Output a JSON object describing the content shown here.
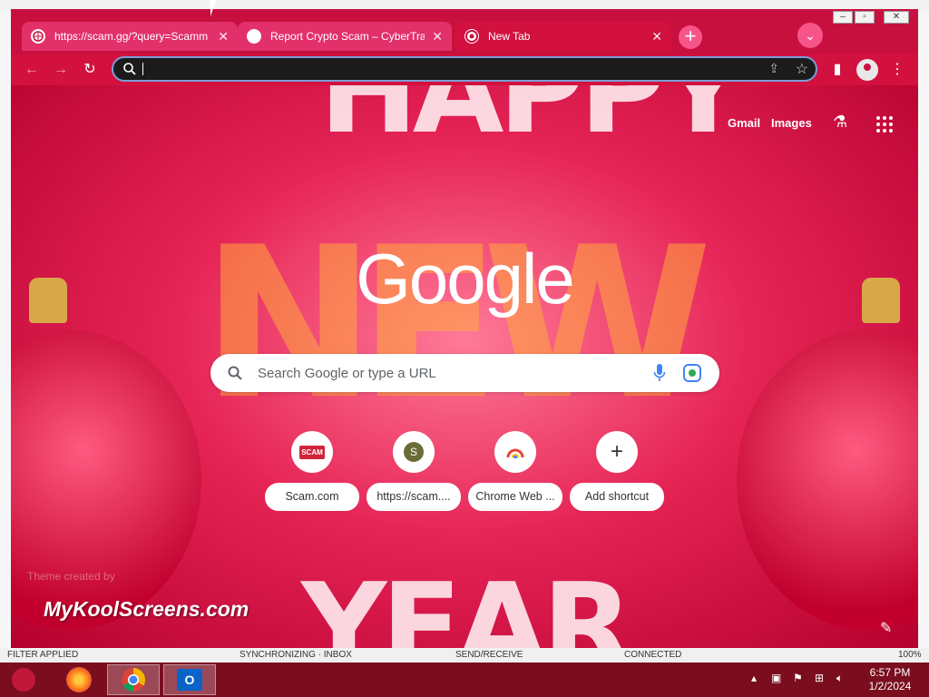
{
  "tabs": [
    {
      "title": "https://scam.gg/?query=Scamm",
      "active": false
    },
    {
      "title": "Report Crypto Scam – CyberTrail",
      "active": false
    },
    {
      "title": "New Tab",
      "active": true
    }
  ],
  "omnibox": {
    "value": ""
  },
  "ntp": {
    "gmail": "Gmail",
    "images": "Images",
    "logo": "Google",
    "search_placeholder": "Search Google or type a URL",
    "shortcuts": [
      {
        "label": "Scam.com",
        "icon_text": "SCAM"
      },
      {
        "label": "https://scam....",
        "icon_text": "S"
      },
      {
        "label": "Chrome Web ...",
        "icon_text": ""
      },
      {
        "label": "Add shortcut",
        "icon_text": "+"
      }
    ],
    "theme_credit": "Theme created by",
    "watermark": "MyKoolScreens.com",
    "art_text_top": "HAPPY",
    "art_text_middle": "NEW",
    "art_text_bottom": "YEAR"
  },
  "statusbar": {
    "filter": "FILTER APPLIED",
    "sync": "SYNCHRONIZING · INBOX",
    "send": "SEND/RECEIVE",
    "connected": "CONNECTED",
    "zoom": "100%"
  },
  "clock": {
    "time": "6:57 PM",
    "date": "1/2/2024"
  },
  "colors": {
    "tabstrip": "#c8103e",
    "accent": "#f7558a",
    "omnibox": "#1b1b1b"
  }
}
